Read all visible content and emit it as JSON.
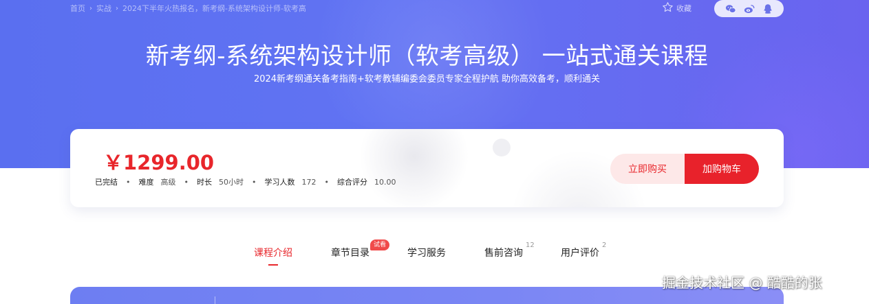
{
  "breadcrumb": {
    "items": [
      "首页",
      "实战",
      "2024下半年火热报名，新考纲-系统架构设计师-软考高"
    ]
  },
  "header": {
    "favorite_label": "收藏",
    "share_icons": [
      "wechat-icon",
      "weibo-icon",
      "qq-icon"
    ]
  },
  "hero": {
    "title": "新考纲-系统架构设计师（软考高级） 一站式通关课程",
    "subtitle": "2024新考纲通关备考指南+软考教辅编委会委员专家全程护航 助你高效备考，顺利通关"
  },
  "card": {
    "price": "￥1299.00",
    "status": "已完结",
    "difficulty_label": "难度",
    "difficulty_value": "高级",
    "duration_label": "时长",
    "duration_value": "50小时",
    "learners_label": "学习人数",
    "learners_value": "172",
    "rating_label": "综合评分",
    "rating_value": "10.00",
    "buy_label": "立即购买",
    "cart_label": "加购物车"
  },
  "tabs": [
    {
      "label": "课程介绍",
      "count": ""
    },
    {
      "label": "章节目录",
      "count": ""
    },
    {
      "label": "学习服务",
      "count": ""
    },
    {
      "label": "售前咨询",
      "count": "12"
    },
    {
      "label": "用户评价",
      "count": "2"
    }
  ],
  "chapter_badge": "试看",
  "watermark": "掘金技术社区 @ 酷酷的张",
  "colors": {
    "accent_red": "#e8262b",
    "hero_blue": "#5a6ff0",
    "hero_purple": "#6a63ef"
  }
}
